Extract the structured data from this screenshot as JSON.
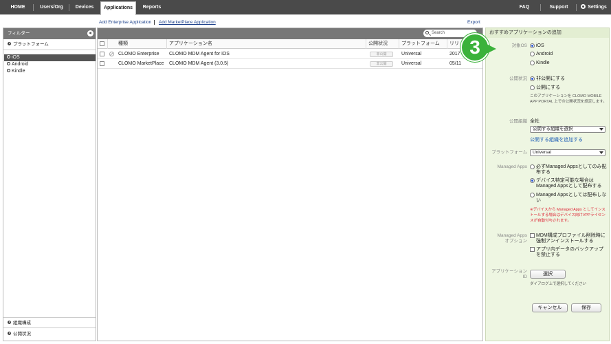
{
  "nav": {
    "home": "HOME",
    "users": "Users/Org",
    "devices": "Devices",
    "applications": "Applications",
    "reports": "Reports",
    "faq": "FAQ",
    "support": "Support",
    "settings": "Settings"
  },
  "sublinks": {
    "add_enterprise": "Add Enterprise Application",
    "add_marketplace": "Add MarketPlace Application",
    "export": "Export"
  },
  "sidebar": {
    "filter_title": "フィルター",
    "platform_section": "プラットフォーム",
    "os_items": [
      "iOS",
      "Android",
      "Kindle"
    ],
    "org_section": "組織構成",
    "publish_section": "公開状況"
  },
  "table": {
    "search_placeholder": "Search",
    "headers": {
      "type": "種類",
      "name": "アプリケーション名",
      "status": "公開状況",
      "platform": "プラットフォーム",
      "release": "リリ"
    },
    "rows": [
      {
        "type": "CLOMO Enterprise",
        "name": "CLOMO MDM Agent for iOS",
        "status": "非公開",
        "platform": "Universal",
        "release": "2017"
      },
      {
        "type": "CLOMO MarketPlace",
        "name": "CLOMO MDM Agent (3.0.5)",
        "status": "非公開",
        "platform": "Universal",
        "release": "05/11"
      }
    ]
  },
  "panel": {
    "title": "おすすめアプリケーションの追加",
    "target_os_label": "対象OS",
    "os_options": [
      "iOS",
      "Android",
      "Kindle"
    ],
    "publish_label": "公開状況",
    "publish_options": [
      "非公開にする",
      "公開にする"
    ],
    "publish_note": "このアプリケーションを CLOMO MOBILE APP PORTAL 上での公開状況を設定します。",
    "org_label": "公開組織",
    "org_value": "全社",
    "org_select": "公開する組織を選択",
    "org_add_link": "公開する組織を追加する",
    "platform_label": "プラットフォーム",
    "platform_value": "Universal",
    "managed_label": "Managed Apps",
    "managed_options": [
      "必ずManaged Appsとしてのみ配布する",
      "デバイス特定可能な場合はManaged Appsとして配布する",
      "Managed Appsとしては配布しない"
    ],
    "managed_note": "※デバイスから Managed Apps としてインストールする場合はデバイス向けVPPライセンスが自動付与されます。",
    "managed_opt_label_1": "Managed Apps",
    "managed_opt_label_2": "オプション",
    "managed_opt_checks": [
      "MDM構成プロファイル削除時に強制アンインストールする",
      "アプリ内データのバックアップを禁止する"
    ],
    "app_id_label_1": "アプリケーション",
    "app_id_label_2": "ID",
    "select_button": "選択",
    "select_note": "ダイアログ上で選択してください",
    "cancel_button": "キャンセル",
    "save_button": "保存"
  },
  "step_badge": "3",
  "colors": {
    "topbar": "#4a4a4a",
    "panel_bg": "#eef6e2",
    "badge": "#3bb23b",
    "link": "#1a3f8a"
  }
}
